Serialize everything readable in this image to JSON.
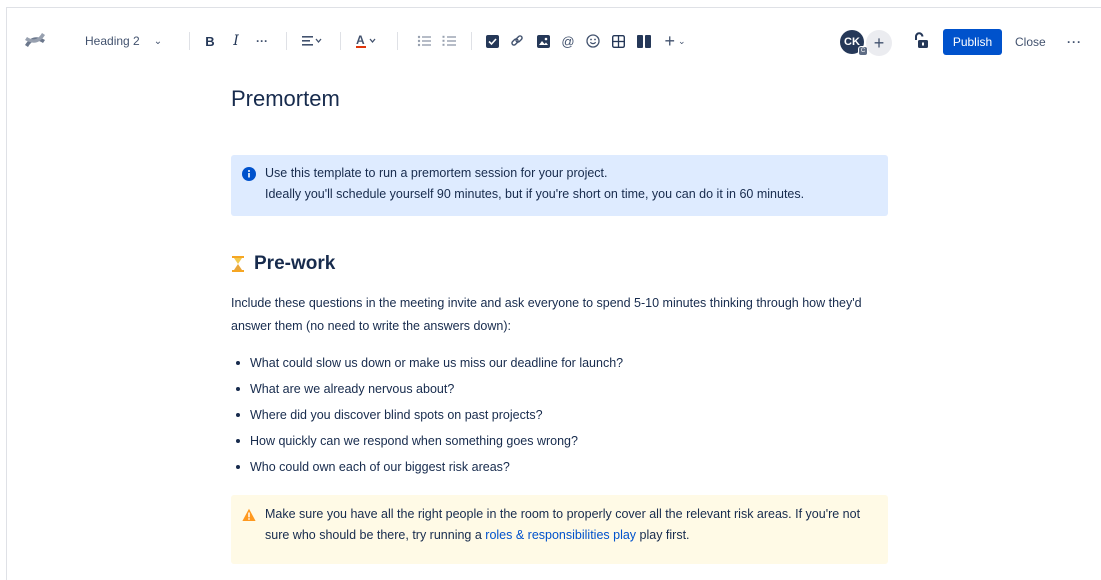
{
  "toolbar": {
    "heading_style": "Heading 2",
    "bold_label": "B",
    "italic_label": "I",
    "more_format_label": "···",
    "insert_label": "+",
    "avatar_initials": "CK",
    "avatar_badge": "C",
    "invite_label": "+",
    "publish_label": "Publish",
    "close_label": "Close",
    "more_actions_label": "···",
    "accent": "#0052cc"
  },
  "page": {
    "title": "Premortem",
    "info_panel": {
      "line1": "Use this template to run a premortem session for your project.",
      "line2": "Ideally you'll schedule yourself 90 minutes, but if you're short on time, you can do it in 60 minutes.",
      "color": "#deebff",
      "icon": "info-icon"
    },
    "section_heading": "Pre-work",
    "section_emoji": "hourglass-icon",
    "intro": "Include these questions in the meeting invite and ask everyone to spend 5-10 minutes thinking through how they'd answer them (no need to write the answers down):",
    "questions": [
      "What could slow us down or make us miss our deadline for launch?",
      "What are we already nervous about?",
      "Where did you discover blind spots on past projects?",
      "How quickly can we respond when something goes wrong?",
      "Who could own each of our biggest risk areas?"
    ],
    "warning_panel": {
      "text_before": "Make sure you have all the right people in the room to properly cover all the relevant risk areas. If you're not sure who should be there, try running a ",
      "link_text": "roles & responsibilities play",
      "text_after": " play first.",
      "color": "#fffae6",
      "icon": "warning-icon"
    }
  }
}
